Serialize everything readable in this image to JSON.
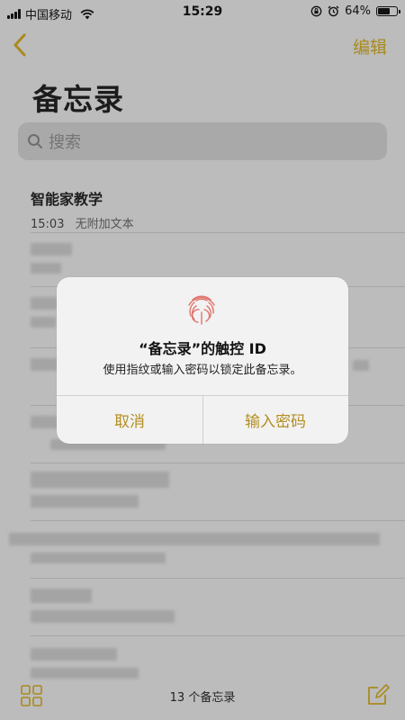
{
  "status_bar": {
    "carrier": "中国移动",
    "time": "15:29",
    "battery": "64%",
    "battery_level": 0.64
  },
  "nav": {
    "edit_label": "编辑"
  },
  "page": {
    "title": "备忘录"
  },
  "search": {
    "placeholder": "搜索"
  },
  "notes": [
    {
      "title": "智能家教学",
      "time": "15:03",
      "preview": "无附加文本"
    }
  ],
  "bottom_bar": {
    "count_label": "13 个备忘录"
  },
  "dialog": {
    "title": "“备忘录”的触控 ID",
    "message": "使用指纹或输入密码以锁定此备忘录。",
    "cancel_label": "取消",
    "enter_password_label": "输入密码"
  },
  "colors": {
    "accent": "#b48e21",
    "dialog_bg": "#f2f2f2",
    "fingerprint": "#e0736c"
  }
}
